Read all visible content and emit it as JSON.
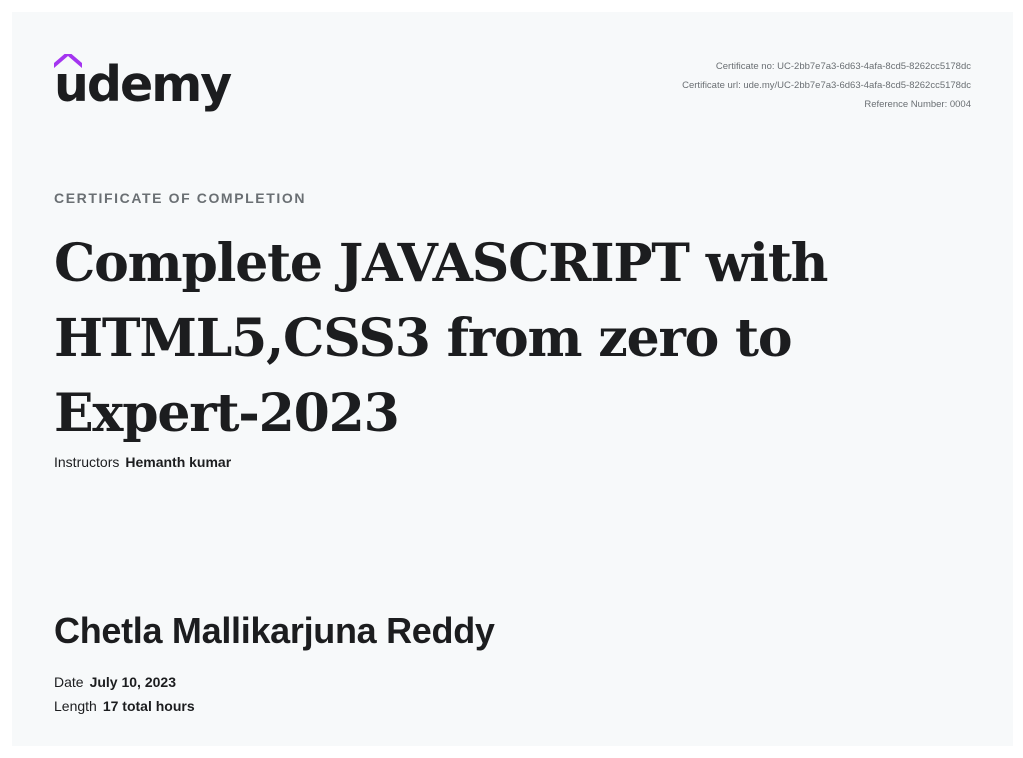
{
  "brand": {
    "name": "udemy",
    "accent_color": "#a435f0",
    "text_color": "#1c1d1f",
    "logo_icon": "udemy-house-icon"
  },
  "certificate_meta": {
    "certificate_no": "Certificate no: UC-2bb7e7a3-6d63-4afa-8cd5-8262cc5178dc",
    "certificate_url": "Certificate url: ude.my/UC-2bb7e7a3-6d63-4afa-8cd5-8262cc5178dc",
    "reference_number": "Reference Number: 0004"
  },
  "eyebrow": "CERTIFICATE OF COMPLETION",
  "course_title": "Complete JAVASCRIPT with HTML5,CSS3 from zero to Expert-2023",
  "instructors": {
    "label": "Instructors",
    "value": "Hemanth kumar"
  },
  "recipient": "Chetla Mallikarjuna Reddy",
  "date": {
    "label": "Date",
    "value": "July 10, 2023"
  },
  "length": {
    "label": "Length",
    "value": "17 total hours"
  }
}
